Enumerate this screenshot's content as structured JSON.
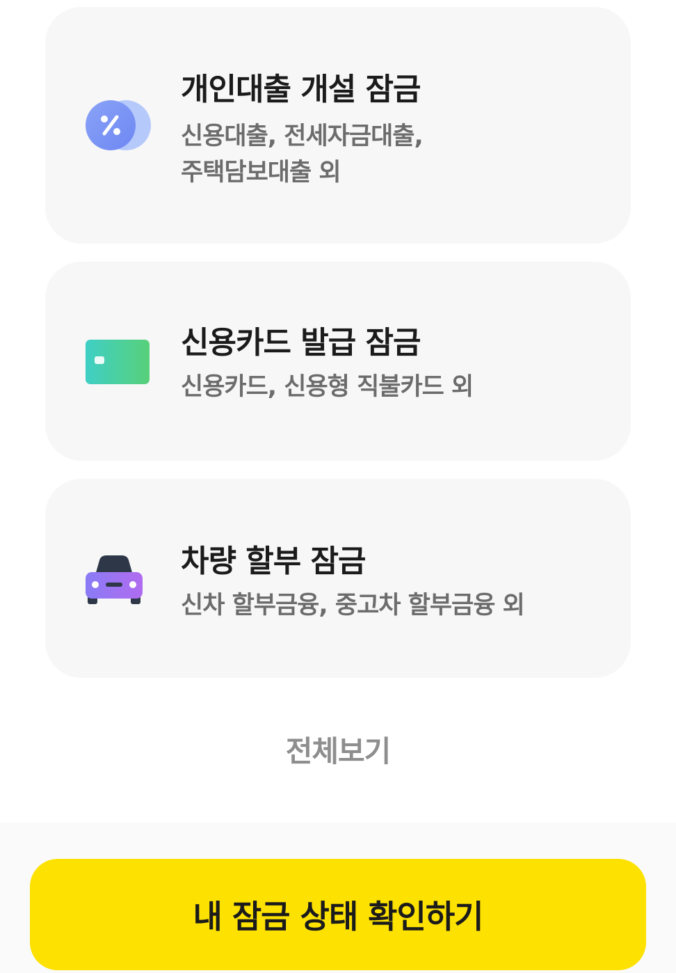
{
  "cards": [
    {
      "icon": "percent-coins-icon",
      "title": "개인대출 개설 잠금",
      "desc_lines": [
        "신용대출, 전세자금대출,",
        "주택담보대출 외"
      ]
    },
    {
      "icon": "credit-card-icon",
      "title": "신용카드 발급 잠금",
      "desc_lines": [
        "신용카드, 신용형 직불카드 외"
      ]
    },
    {
      "icon": "car-icon",
      "title": "차량 할부 잠금",
      "desc_lines": [
        "신차 할부금융, 중고차 할부금융 외"
      ]
    }
  ],
  "view_all_label": "전체보기",
  "cta_label": "내 잠금 상태 확인하기",
  "colors": {
    "card_bg": "#f7f7f7",
    "title": "#1b1b1b",
    "desc": "#6c6c6c",
    "view_all": "#8e8e8e",
    "cta_bg": "#fde100"
  }
}
